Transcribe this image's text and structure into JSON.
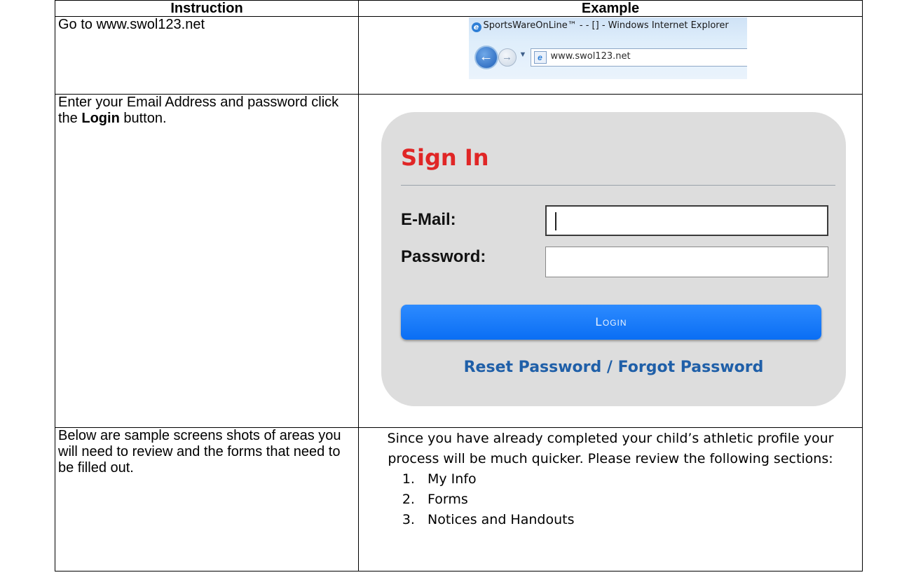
{
  "table": {
    "headers": {
      "instruction": "Instruction",
      "example": "Example"
    },
    "rows": [
      {
        "instruction": "Go to www.swol123.net"
      },
      {
        "instruction_pre": "Enter your Email Address and password click the ",
        "instruction_bold": "Login",
        "instruction_post": " button."
      },
      {
        "instruction": "Below are sample screens shots of areas you will need to review and the forms that need to be filled out."
      }
    ]
  },
  "browser": {
    "title": "SportsWareOnLine™ - - [] - Windows Internet Explorer",
    "address": "www.swol123.net",
    "logo_icon": "ie-logo-icon",
    "back_icon": "back-arrow-icon",
    "forward_icon": "forward-arrow-icon"
  },
  "signin": {
    "title": "Sign In",
    "email_label": "E-Mail:",
    "password_label": "Password:",
    "email_value": "",
    "password_value": "",
    "login_label": "Login",
    "reset_link": "Reset Password / Forgot Password",
    "title_color": "#e02626",
    "button_color": "#0a6ef4",
    "link_color": "#1f5fa8"
  },
  "review": {
    "text": "Since you have already completed your child’s athletic profile your process will be much quicker.  Please review the following sections:",
    "sections": [
      "My Info",
      "Forms",
      "Notices and Handouts"
    ]
  }
}
